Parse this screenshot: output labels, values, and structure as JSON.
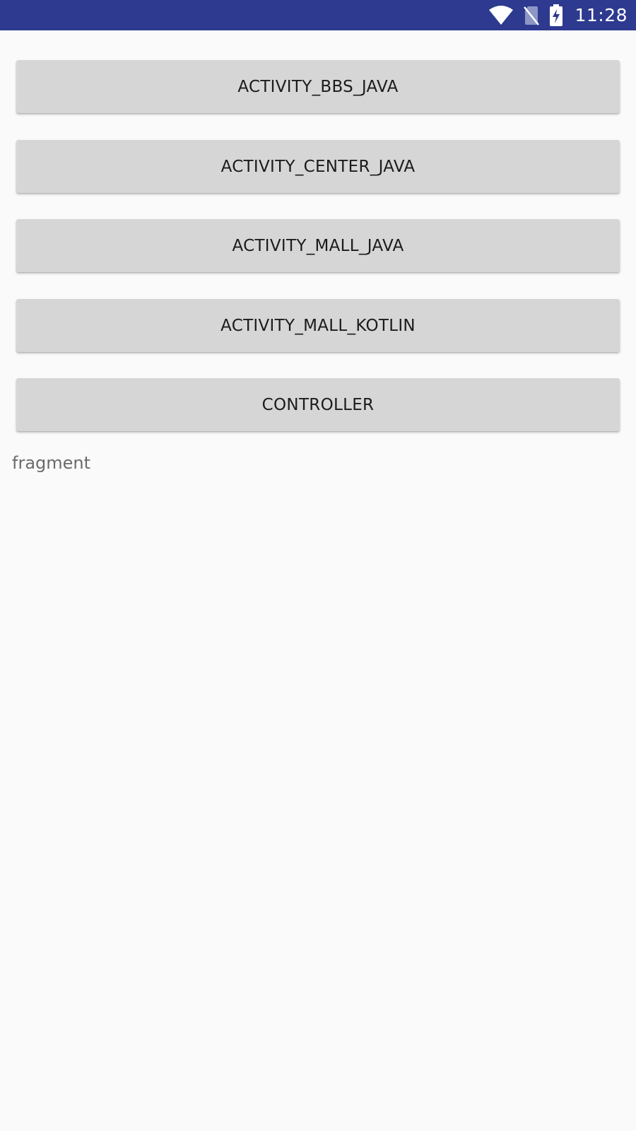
{
  "status_bar": {
    "time": "11:28",
    "icons": [
      "wifi-icon",
      "no-sim-icon",
      "battery-charging-icon"
    ],
    "background_color": "#2d3a8f"
  },
  "buttons": [
    {
      "label": "ACTIVITY_BBS_JAVA"
    },
    {
      "label": "ACTIVITY_CENTER_JAVA"
    },
    {
      "label": "ACTIVITY_MALL_JAVA"
    },
    {
      "label": "ACTIVITY_MALL_KOTLIN"
    },
    {
      "label": "CONTROLLER"
    }
  ],
  "fragment_container": {
    "text": "fragment"
  }
}
